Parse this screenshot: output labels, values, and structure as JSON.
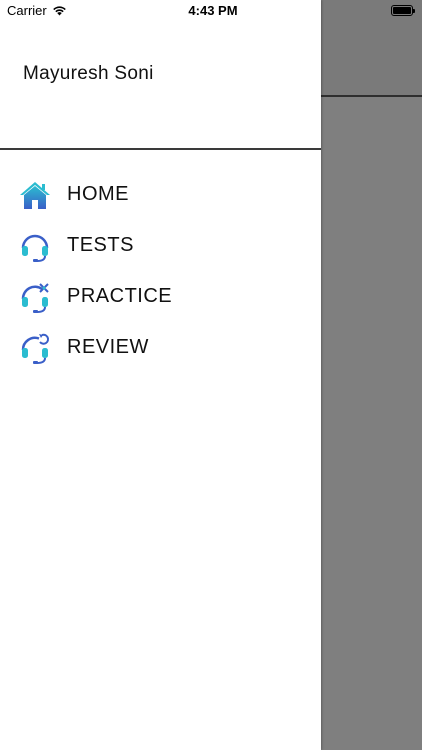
{
  "status_bar": {
    "carrier": "Carrier",
    "time": "4:43 PM"
  },
  "drawer": {
    "user_name": "Mayuresh Soni",
    "menu": [
      {
        "label": "HOME",
        "icon": "home-icon"
      },
      {
        "label": "TESTS",
        "icon": "headset-icon"
      },
      {
        "label": "PRACTICE",
        "icon": "headset-tools-icon"
      },
      {
        "label": "REVIEW",
        "icon": "headset-refresh-icon"
      }
    ]
  },
  "colors": {
    "icon_teal": "#2bbcd0",
    "icon_blue": "#3a5fc8",
    "overlay_gray": "#7f7f7f"
  }
}
